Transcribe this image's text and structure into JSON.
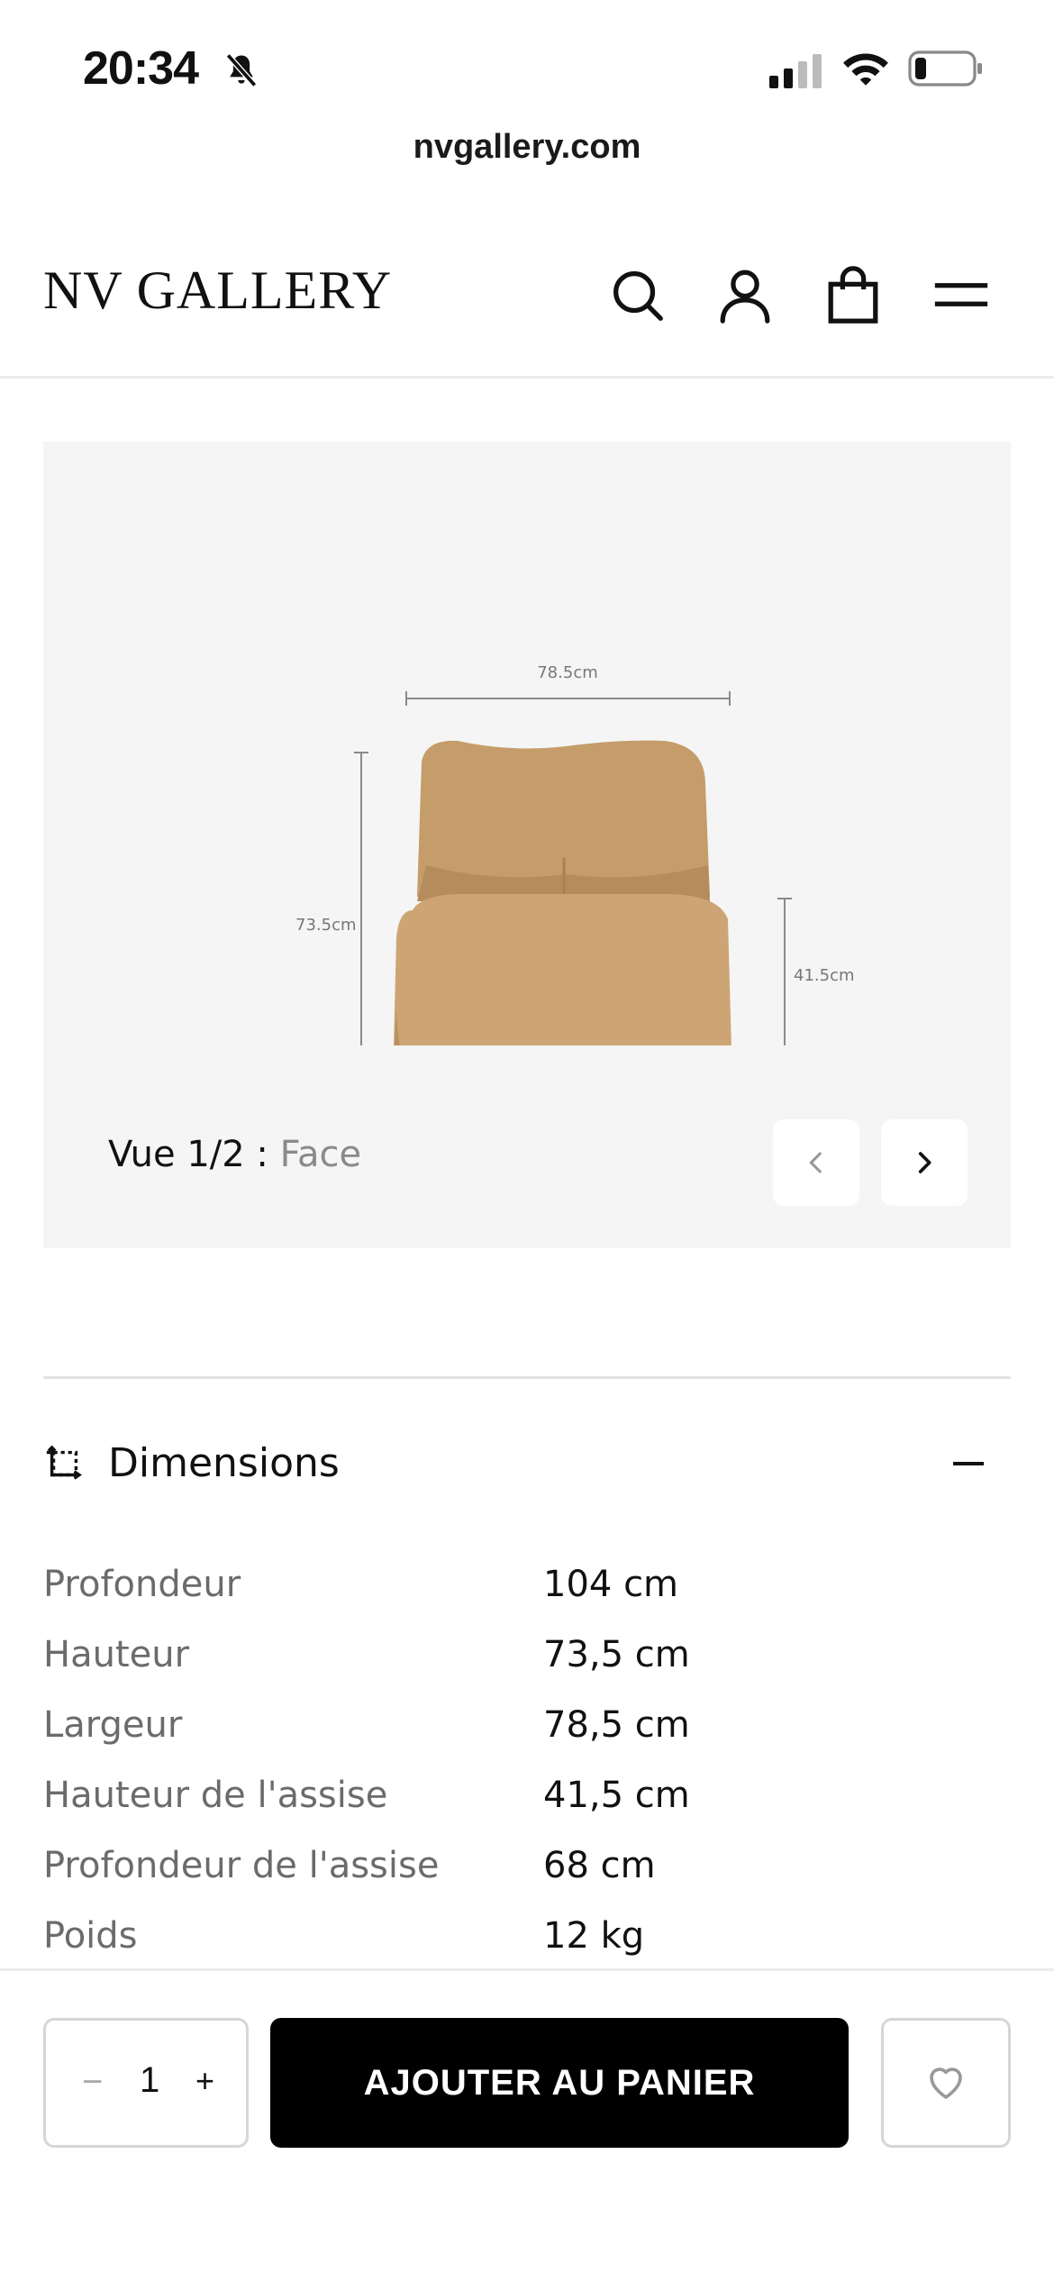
{
  "status_bar": {
    "time": "20:34"
  },
  "browser": {
    "url": "nvgallery.com"
  },
  "header": {
    "logo": "NV GALLERY",
    "icons": [
      "search-icon",
      "account-icon",
      "bag-icon",
      "menu-icon"
    ]
  },
  "gallery": {
    "view_prefix": "Vue 1/2 : ",
    "view_name": "Face",
    "image_dims": {
      "width": "78.5cm",
      "height": "73.5cm",
      "seat_height": "41.5cm"
    }
  },
  "dimensions": {
    "title": "Dimensions",
    "rows": [
      {
        "label": "Profondeur",
        "value": "104 cm"
      },
      {
        "label": "Hauteur",
        "value": "73,5 cm"
      },
      {
        "label": "Largeur",
        "value": "78,5 cm"
      },
      {
        "label": "Hauteur de l'assise",
        "value": "41,5 cm"
      },
      {
        "label": "Profondeur de l'assise",
        "value": "68 cm"
      },
      {
        "label": "Poids",
        "value": "12 kg"
      }
    ]
  },
  "cart": {
    "quantity": "1",
    "minus": "−",
    "plus": "+",
    "add_label": "AJOUTER AU PANIER"
  },
  "colors": {
    "accent": "#000000",
    "gallery_bg": "#f5f5f5",
    "muted_text": "#6b6b6b",
    "fabric": "#c9a26e"
  }
}
